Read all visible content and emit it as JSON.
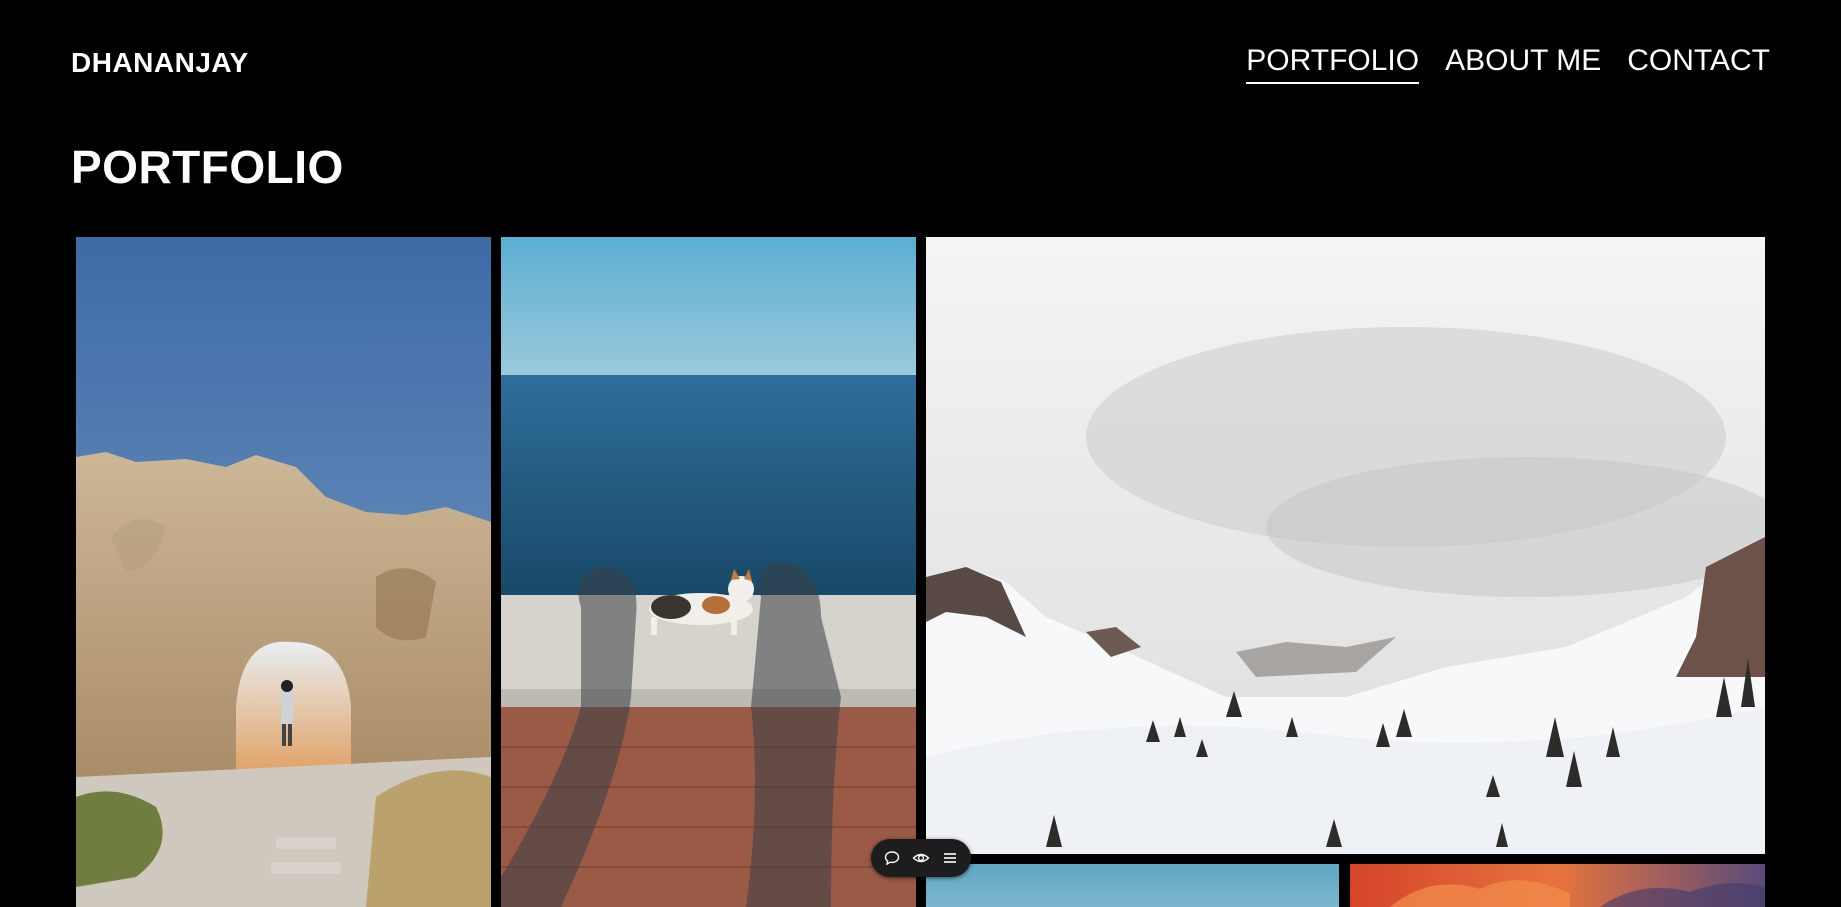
{
  "header": {
    "logo": "DHANANJAY",
    "nav": [
      {
        "label": "PORTFOLIO",
        "active": true
      },
      {
        "label": "ABOUT ME",
        "active": false
      },
      {
        "label": "CONTACT",
        "active": false
      }
    ]
  },
  "main": {
    "title": "PORTFOLIO",
    "gallery": [
      {
        "subject": "desert rock arch with person"
      },
      {
        "subject": "cat on seawall by the ocean"
      },
      {
        "subject": "snowy mountain slope with pine trees"
      },
      {
        "subject": "blue sky"
      },
      {
        "subject": "sunset clouds"
      }
    ]
  },
  "toolbar": {
    "icons": [
      "comment-icon",
      "eye-icon",
      "menu-icon"
    ]
  },
  "colors": {
    "background": "#000000",
    "text": "#ffffff",
    "toolbar": "#1d1d1d"
  }
}
